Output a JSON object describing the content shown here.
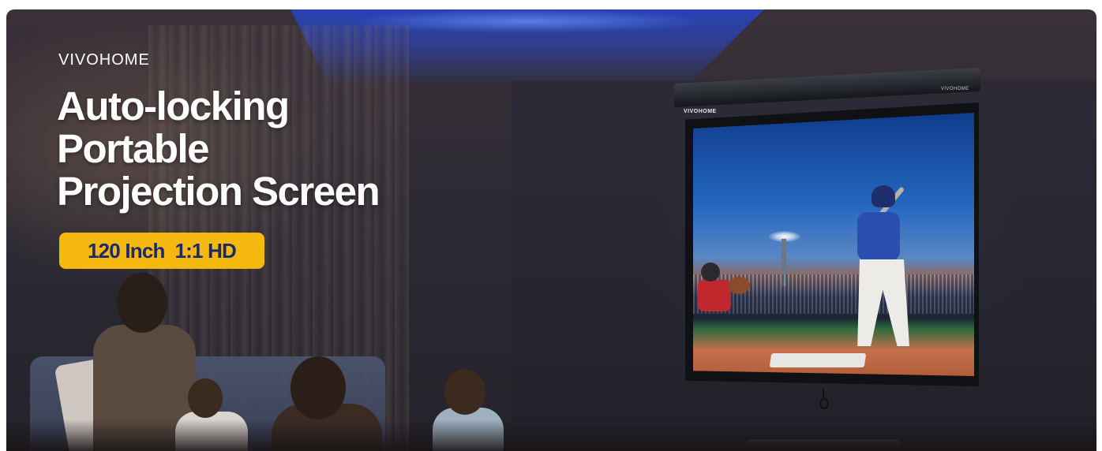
{
  "banner": {
    "brand": "VIVOHOME",
    "headline_lines": [
      "Auto-locking",
      "Portable",
      "Projection Screen"
    ],
    "spec_badge": "120 Inch  1:1 HD",
    "screen_housing_brand_left": "VIVOHOME",
    "screen_housing_brand_right": "VIVOHOME"
  },
  "colors": {
    "badge_bg": "#f4b80f",
    "badge_text": "#1b2b6a",
    "headline_text": "#ffffff",
    "ceiling_light": "#2446c9"
  },
  "icons": {
    "pull_handle": "pull-cord-ring-icon"
  }
}
